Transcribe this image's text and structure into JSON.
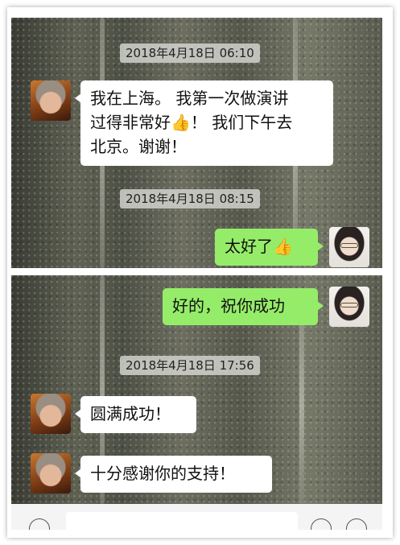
{
  "messages": {
    "ts1": "2018年4月18日 06:10",
    "m1_line1": "我在上海。 我第一次做演讲",
    "m1_line2_a": "过得非常好",
    "m1_line2_b": "！ 我们下午去",
    "m1_line3": "北京。谢谢！",
    "ts2": "2018年4月18日 08:15",
    "m2": "太好了",
    "m3": "好的，祝你成功",
    "ts3": "2018年4月18日 17:56",
    "m4": "圆满成功！",
    "m5": "十分感谢你的支持！"
  },
  "icons": {
    "thumbs_up": "👍"
  },
  "colors": {
    "sent_bubble": "#95ec69",
    "received_bubble": "#ffffff"
  }
}
